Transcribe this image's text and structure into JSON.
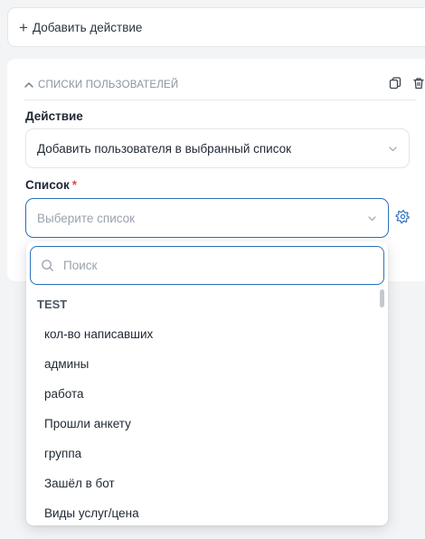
{
  "add_action": {
    "label": "Добавить действие"
  },
  "card": {
    "section_title": "СПИСКИ ПОЛЬЗОВАТЕЛЕЙ",
    "action_label": "Действие",
    "action_value": "Добавить пользователя в выбранный список",
    "list_label": "Список",
    "list_required_mark": "*",
    "list_placeholder": "Выберите список"
  },
  "dropdown": {
    "search_placeholder": "Поиск",
    "group_header": "TEST",
    "options": [
      "кол-во написавших",
      "админы",
      "работа",
      "Прошли анкету",
      "группа",
      "Зашёл в бот",
      "Виды услуг/цена"
    ]
  },
  "colors": {
    "accent": "#2c6fbb",
    "required": "#e5484d",
    "background": "#f3f4f6"
  }
}
